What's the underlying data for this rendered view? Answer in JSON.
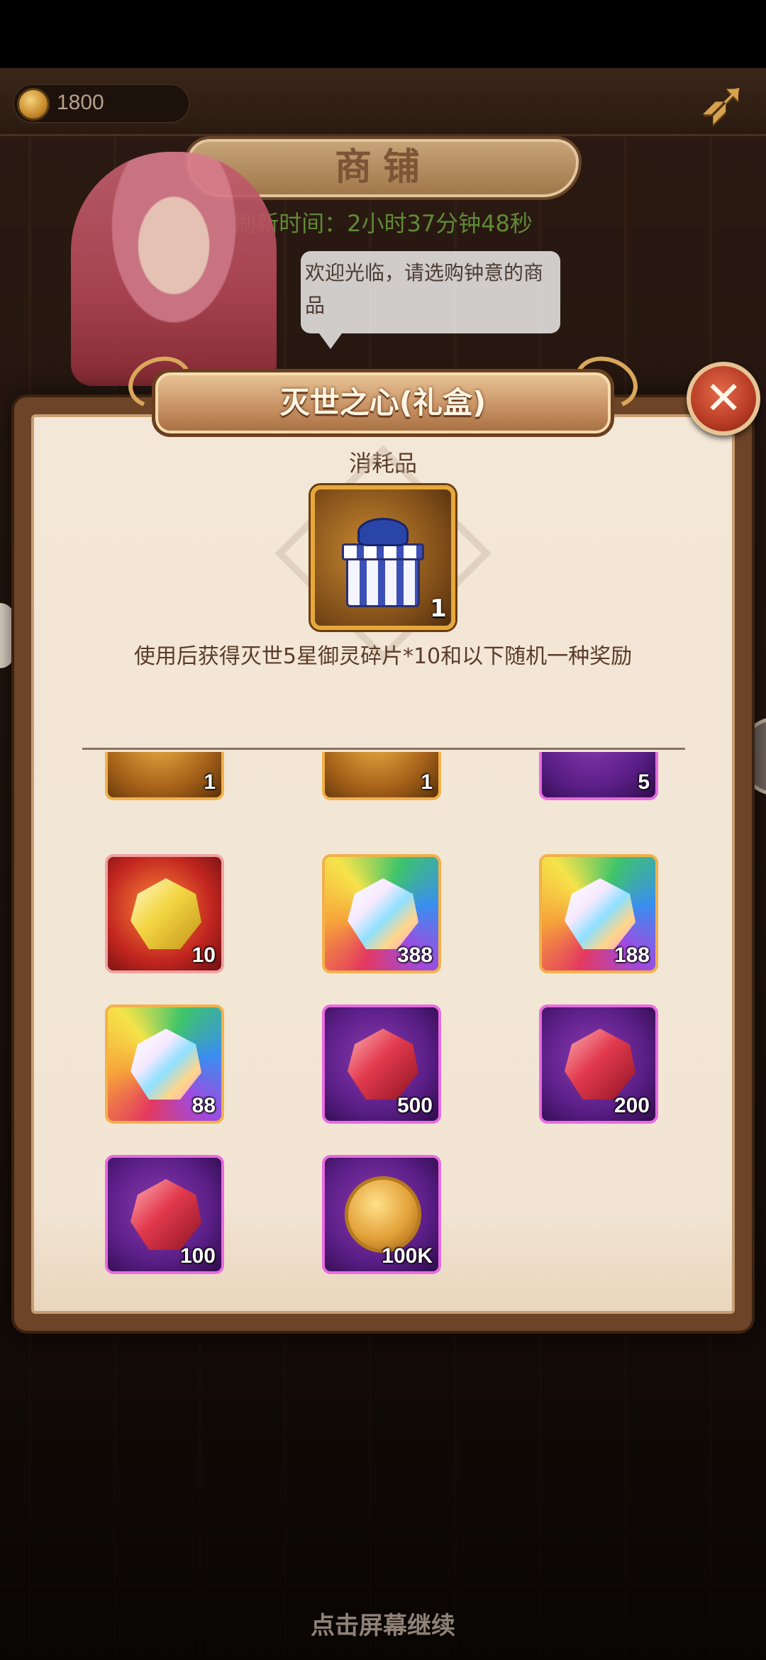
{
  "header": {
    "coin_amount": "1800",
    "shop_title": "商铺",
    "refresh_text": "刷新时间：2小时37分钟48秒",
    "speech": "欢迎光临，请选购钟意的商品"
  },
  "modal": {
    "title": "灭世之心(礼盒)",
    "category": "消耗品",
    "main_item": {
      "icon": "gift-box-icon",
      "count": "1"
    },
    "description": "使用后获得灭世5星御灵碎片*10和以下随机一种奖励",
    "close_icon": "close-x-icon"
  },
  "rewards": [
    {
      "icon": "crystal-shard-icon",
      "frame": "gold",
      "count": "1"
    },
    {
      "icon": "golden-crown-icon",
      "frame": "gold",
      "count": "1"
    },
    {
      "icon": "scroll-icon",
      "frame": "purple",
      "count": "5"
    },
    {
      "icon": "yellow-gem-icon",
      "frame": "red",
      "count": "10"
    },
    {
      "icon": "rainbow-crystal-icon",
      "frame": "rainbow",
      "count": "388"
    },
    {
      "icon": "rainbow-crystal-icon",
      "frame": "rainbow",
      "count": "188"
    },
    {
      "icon": "rainbow-crystal-icon",
      "frame": "rainbow",
      "count": "88"
    },
    {
      "icon": "ruby-icon",
      "frame": "purple",
      "count": "500"
    },
    {
      "icon": "ruby-icon",
      "frame": "purple",
      "count": "200"
    },
    {
      "icon": "ruby-icon",
      "frame": "purple",
      "count": "100"
    },
    {
      "icon": "gold-coin-icon",
      "frame": "purple",
      "count": "100K"
    }
  ],
  "footer": {
    "continue_hint": "点击屏幕继续"
  },
  "colors": {
    "panel_bg": "#f2e5d4",
    "frame_brown": "#6d4427",
    "refresh_green": "#5f8a36",
    "close_red": "#b73b24"
  }
}
